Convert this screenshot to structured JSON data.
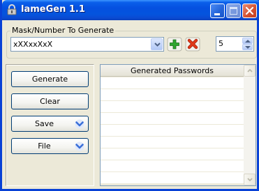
{
  "window": {
    "title": "lameGen 1.1"
  },
  "mask_group": {
    "legend": "Mask/Number To Generate",
    "mask_value": "xXXxxXxX",
    "count_value": "5"
  },
  "buttons": {
    "generate": "Generate",
    "clear": "Clear",
    "save": "Save",
    "file": "File"
  },
  "grid": {
    "header": "Generated Passwords",
    "rows": [
      "",
      "",
      "",
      "",
      "",
      "",
      "",
      "",
      ""
    ]
  },
  "colors": {
    "titlebar": "#0550e0",
    "window_bg": "#ece9d8",
    "add_icon": "#2fa52f",
    "remove_icon": "#e03a1a",
    "dropdown_chevron": "#3a6fd8"
  },
  "icons": {
    "app": "padlock-icon",
    "add": "green-plus-icon",
    "remove": "red-x-icon"
  }
}
